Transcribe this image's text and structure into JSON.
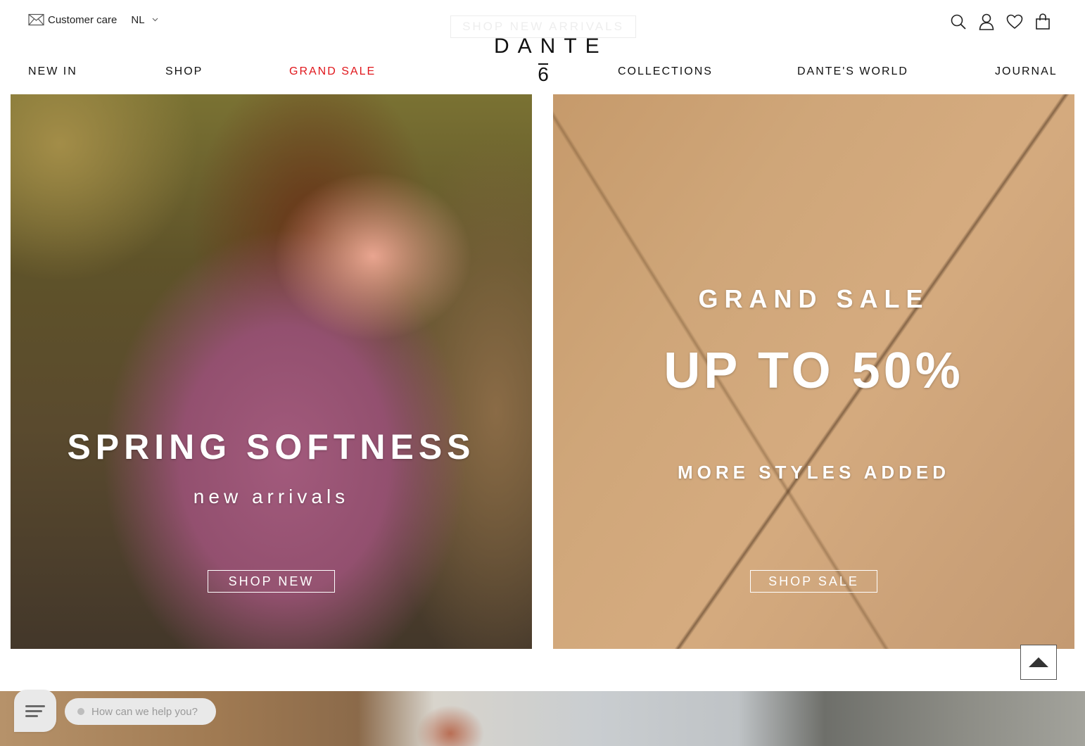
{
  "header": {
    "ghost_cta": "SHOP NEW ARRIVALS",
    "customer_care": "Customer care",
    "language": "NL",
    "logo": {
      "word": "DANTE",
      "number": "6"
    },
    "icons": [
      "search-icon",
      "account-icon",
      "wishlist-heart-icon",
      "shopping-bag-icon"
    ]
  },
  "nav": {
    "new_in": "NEW IN",
    "shop": "SHOP",
    "grand_sale": "GRAND SALE",
    "collections": "COLLECTIONS",
    "dantes_world": "DANTE'S WORLD",
    "journal": "JOURNAL"
  },
  "hero_left": {
    "title": "SPRING SOFTNESS",
    "subtitle": "new arrivals",
    "button": "SHOP NEW"
  },
  "hero_right": {
    "kicker": "GRAND SALE",
    "headline": "UP TO 50%",
    "subline": "MORE STYLES ADDED",
    "button": "SHOP SALE"
  },
  "chat": {
    "placeholder": "How can we help you?"
  },
  "colors": {
    "sale_accent": "#e0161b",
    "text": "#111111",
    "chat_bg": "#e9e9e9"
  }
}
